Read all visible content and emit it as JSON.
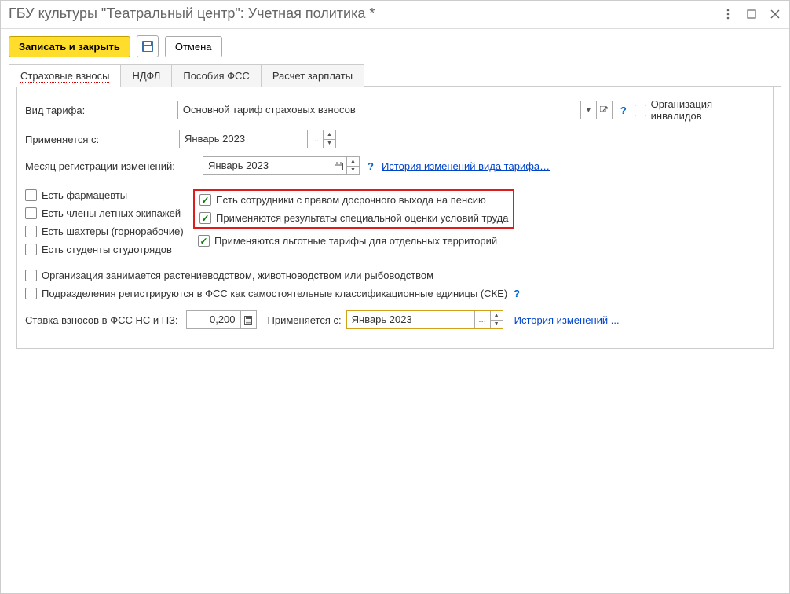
{
  "window_title": "ГБУ культуры \"Театральный центр\": Учетная политика *",
  "toolbar": {
    "save_close": "Записать и закрыть",
    "cancel": "Отмена"
  },
  "tabs": {
    "t1": "Страховые взносы",
    "t2": "НДФЛ",
    "t3": "Пособия ФСС",
    "t4": "Расчет зарплаты"
  },
  "form": {
    "tariff_label": "Вид тарифа:",
    "tariff_value": "Основной тариф страховых взносов",
    "org_disabled": "Организация инвалидов",
    "applies_from_label": "Применяется с:",
    "applies_from_value": "Январь 2023",
    "month_reg_label": "Месяц регистрации изменений:",
    "month_reg_value": "Январь 2023",
    "history_tariff_link": "История изменений вида тарифа…",
    "chk_pharma": "Есть фармацевты",
    "chk_flight": "Есть члены летных экипажей",
    "chk_miners": "Есть шахтеры (горнорабочие)",
    "chk_students": "Есть студенты студотрядов",
    "chk_pension": "Есть сотрудники с правом досрочного выхода на пенсию",
    "chk_sout": "Применяются результаты специальной оценки условий труда",
    "chk_territories": "Применяются льготные тарифы для отдельных территорий",
    "chk_agro": "Организация занимается растениеводством, животноводством или рыбоводством",
    "chk_fss_units": "Подразделения регистрируются в ФСС как самостоятельные классификационные единицы (СКЕ)",
    "fss_rate_label": "Ставка взносов в ФСС НС и ПЗ:",
    "fss_rate_value": "0,200",
    "applies2_label": "Применяется с:",
    "applies2_value": "Январь 2023",
    "history2_link": "История изменений ..."
  }
}
